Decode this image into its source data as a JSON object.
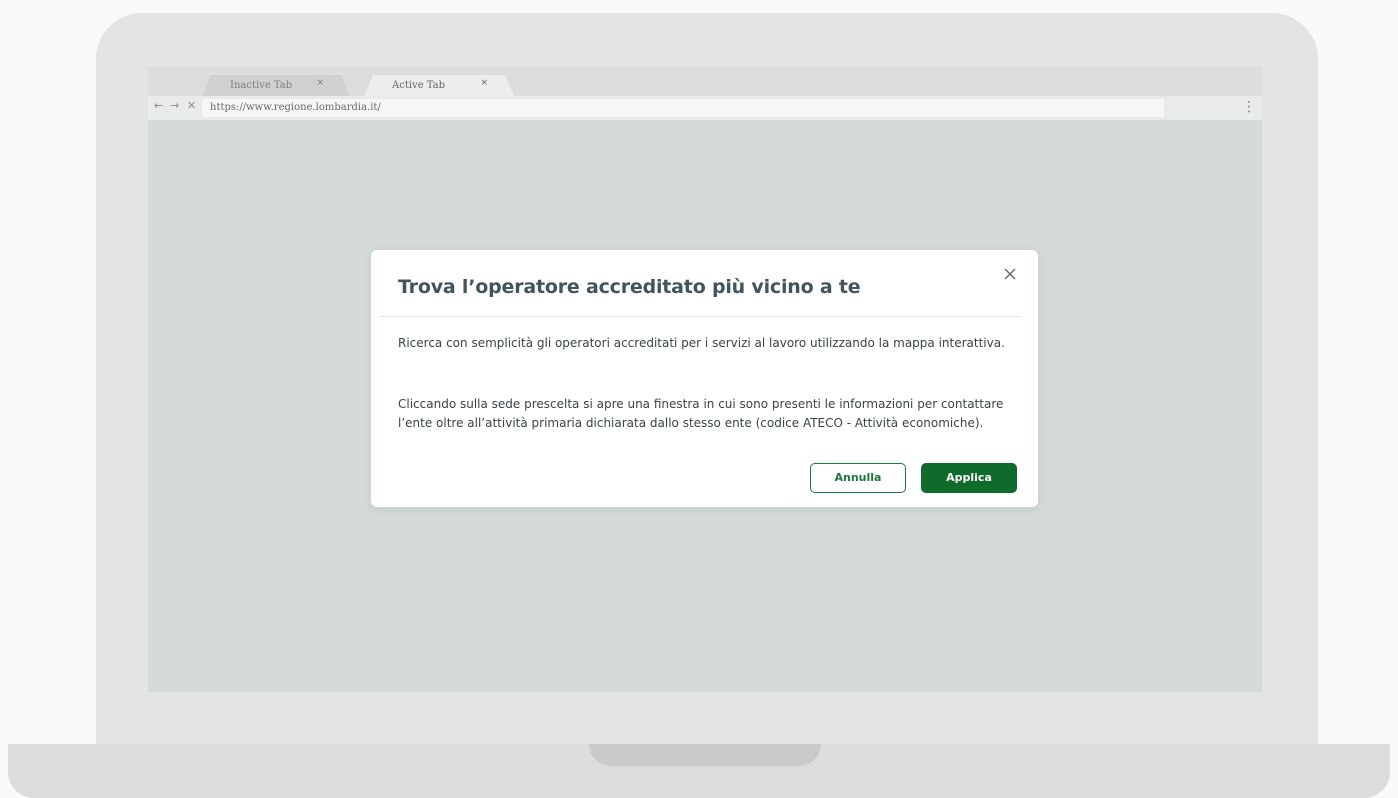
{
  "browser": {
    "tabs": [
      {
        "label": "Inactive Tab",
        "close": "×",
        "active": false
      },
      {
        "label": "Active Tab",
        "close": "×",
        "active": true
      }
    ],
    "nav": {
      "back": "←",
      "forward": "→",
      "stop": "✕"
    },
    "url": "https://www.regione.lombardia.it/",
    "menu": "⋮"
  },
  "modal": {
    "title": "Trova l’operatore accreditato più vicino a te",
    "paragraph1": "Ricerca con semplicità gli operatori accreditati per i servizi al lavoro utilizzando la mappa interattiva.",
    "paragraph2": "Cliccando sulla sede prescelta si apre una finestra in cui sono presenti le informazioni per contattare l’ente oltre all’attività primaria dichiarata dallo stesso ente (codice ATECO - Attività economiche).",
    "cancel_label": "Annulla",
    "apply_label": "Applica"
  },
  "colors": {
    "primary": "#0e6b2c",
    "title": "#41555f",
    "overlay": "#d4dbd6"
  }
}
